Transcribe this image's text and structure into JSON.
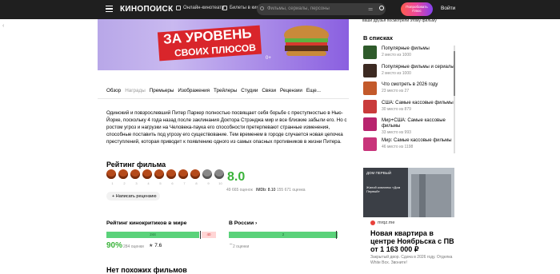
{
  "header": {
    "logo": "КИНОПОИСК",
    "nav": [
      "Онлайн-кинотеатр",
      "Билеты в кино"
    ],
    "search_placeholder": "Фильмы, сериалы, персоны",
    "plus_button": "Попробовать Плюс",
    "login": "Войти"
  },
  "banner": {
    "line1": "ЗА УРОВЕНЬ",
    "line2": "СВОИХ ПЛЮСОВ",
    "age": "0+"
  },
  "sidebar": {
    "note": "ваши друзья посмотрели этому фильму",
    "lists_title": "В списках",
    "lists": [
      {
        "title": "Популярные фильмы",
        "sub": "2 место из 1000",
        "color": "#2e5a2a"
      },
      {
        "title": "Популярные фильмы и сериалы",
        "sub": "2 место из 1000",
        "color": "#3c2a22"
      },
      {
        "title": "Что смотреть в 2026 году",
        "sub": "23 место из 27",
        "color": "#c3592a"
      },
      {
        "title": "США: Самые кассовые фильмы",
        "sub": "30 место из 879",
        "color": "#c93b3b"
      },
      {
        "title": "Мир+США: Самые кассовые фильмы",
        "sub": "33 место из 993",
        "color": "#b8246e"
      },
      {
        "title": "Мир: Самые кассовые фильмы",
        "sub": "46 место из 1198",
        "color": "#c8347a"
      }
    ],
    "ad": {
      "logo": "ДОМ ПЕРВЫЙ",
      "text": "Жилой комплекс «Дом Первый»",
      "brand": "mrqz.me",
      "title": "Новая квартира в центре Ноябрьска с ПВ от 1 163 000 ₽",
      "foot": "Закрытый двор. Сдача в 2026 году. Отделка White Box. Звоните!"
    }
  },
  "tabs": [
    "Обзор",
    "Награды",
    "Премьеры",
    "Изображения",
    "Трейлеры",
    "Студии",
    "Связи",
    "Рецензии",
    "Еще..."
  ],
  "description": "Одинокий и повзрослевший Питер Паркер полностью посвящает себя борьбе с преступностью в Нью-Йорке, поскольку 4 года назад после заклинания Доктора Стрэнджа мир и все близкие забыли его. Но с ростом угроз и нагрузки на Человека-паука его способности претерпевают странные изменения, способные поставить под угрозу его существование. Тем временем в городе случается новая цепочка преступлений, которая приводит к появлению одного из самых опасных противников в жизни Питера.",
  "rating": {
    "title": "Рейтинг фильма",
    "circles": [
      "1",
      "2",
      "3",
      "4",
      "5",
      "6",
      "7",
      "8",
      "9",
      "10"
    ],
    "score": "8.0",
    "votes": "49 665 оценок",
    "imdb_label": "IMDb: 8.10",
    "imdb_votes": "155 671 оценка",
    "write_review": "Написать рецензию"
  },
  "critics": {
    "title": "Рейтинг кинокритиков в мире",
    "positive": "244",
    "negative": "40",
    "positive_share": 0.859,
    "percent": "90%",
    "count": "284 оценки",
    "average": "7.6"
  },
  "russia": {
    "title": "В России",
    "positive": "2",
    "dash": "–",
    "count": "2 оценки"
  },
  "similar_title": "Нет похожих фильмов"
}
